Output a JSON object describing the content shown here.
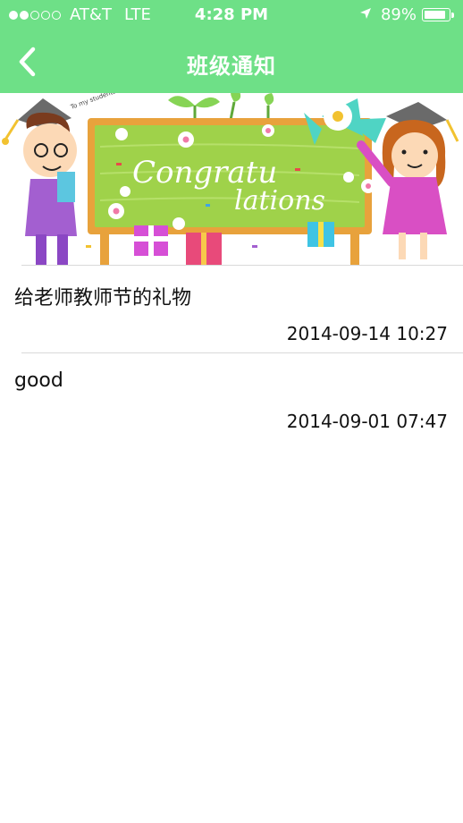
{
  "status_bar": {
    "carrier": "AT&T",
    "network": "LTE",
    "time": "4:28 PM",
    "battery_percent": "89%",
    "battery_level": 0.89,
    "signal_bars_filled": 2,
    "signal_bars_total": 5
  },
  "nav": {
    "title": "班级通知",
    "back_icon": "chevron-left-icon"
  },
  "banner": {
    "text_line1": "Congratu",
    "text_line2": "lations",
    "small_text": "To my students"
  },
  "notices": [
    {
      "title": "给老师教师节的礼物",
      "date": "2014-09-14 10:27"
    },
    {
      "title": "good",
      "date": "2014-09-01 07:47"
    }
  ],
  "colors": {
    "header": "#6ee087",
    "divider": "#d9d9d9"
  }
}
